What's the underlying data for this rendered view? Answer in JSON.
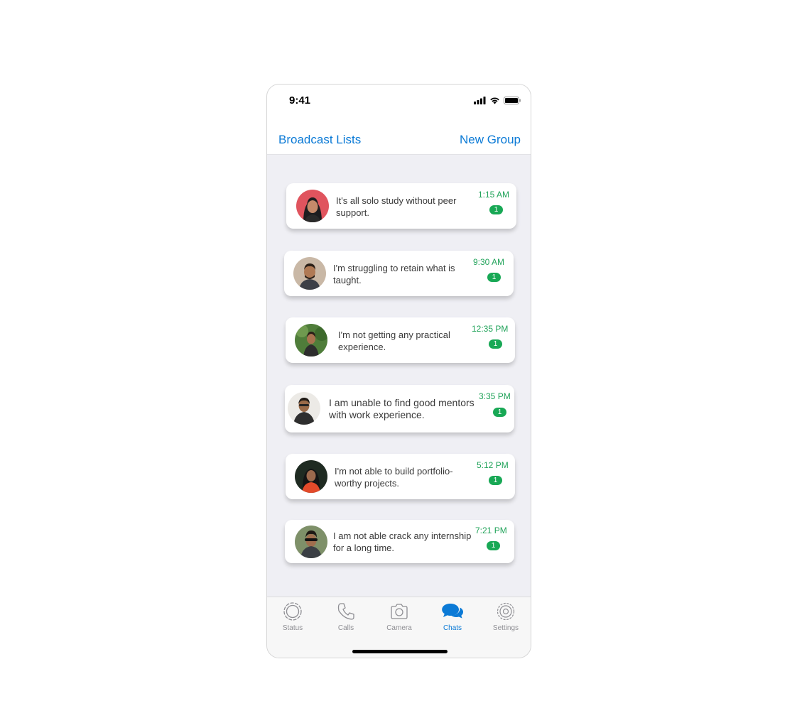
{
  "status_bar": {
    "time": "9:41"
  },
  "nav": {
    "left_label": "Broadcast Lists",
    "right_label": "New Group"
  },
  "chats": [
    {
      "message": "It's all solo study without peer support.",
      "time": "1:15 AM",
      "unread": "1"
    },
    {
      "message": "I'm struggling to retain what is taught.",
      "time": "9:30 AM",
      "unread": "1"
    },
    {
      "message": "I'm not getting any practical experience.",
      "time": "12:35 PM",
      "unread": "1"
    },
    {
      "message": "I am unable to find good mentors with work experience.",
      "time": "3:35 PM",
      "unread": "1"
    },
    {
      "message": "I'm not able to build portfolio-worthy projects.",
      "time": "5:12 PM",
      "unread": "1"
    },
    {
      "message": "I am not able crack any internship for a long time.",
      "time": "7:21 PM",
      "unread": "1"
    }
  ],
  "tabs": [
    {
      "label": "Status",
      "icon": "status-icon"
    },
    {
      "label": "Calls",
      "icon": "phone-icon"
    },
    {
      "label": "Camera",
      "icon": "camera-icon"
    },
    {
      "label": "Chats",
      "icon": "chat-bubbles-icon",
      "active": true
    },
    {
      "label": "Settings",
      "icon": "gear-icon"
    }
  ],
  "colors": {
    "accent": "#0b7ad6",
    "timestamp": "#21a35a",
    "badge": "#18a855",
    "background": "#efeff4"
  }
}
